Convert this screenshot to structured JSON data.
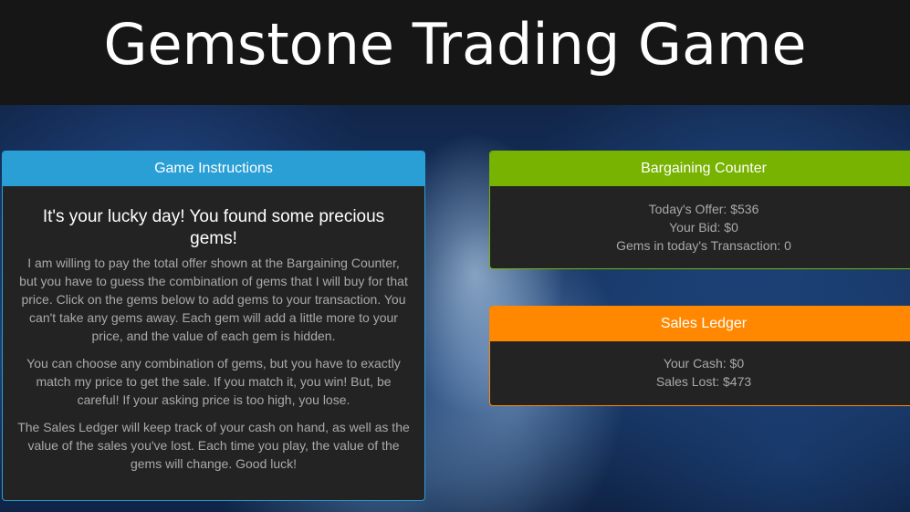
{
  "header": {
    "title": "Gemstone Trading Game"
  },
  "instructions": {
    "title": "Game Instructions",
    "heading": "It's your lucky day! You found some precious gems!",
    "paragraphs": [
      "I am willing to pay the total offer shown at the Bargaining Counter, but you have to guess the combination of gems that I will buy for that price. Click on the gems below to add gems to your transaction. You can't take any gems away. Each gem will add a little more to your price, and the value of each gem is hidden.",
      "You can choose any combination of gems, but you have to exactly match my price to get the sale. If you match it, you win! But, be careful! If your asking price is too high, you lose.",
      "The Sales Ledger will keep track of your cash on hand, as well as the value of the sales you've lost. Each time you play, the value of the gems will change. Good luck!"
    ],
    "accent_color": "#2a9fd6"
  },
  "bargaining_counter": {
    "title": "Bargaining Counter",
    "offer": "Today's Offer: $536",
    "bid": "Your Bid: $0",
    "gems_count": "Gems in today's Transaction: 0",
    "accent_color": "#77b300"
  },
  "sales_ledger": {
    "title": "Sales Ledger",
    "cash": "Your Cash: $0",
    "lost": "Sales Lost: $473",
    "accent_color": "#ff8800"
  }
}
